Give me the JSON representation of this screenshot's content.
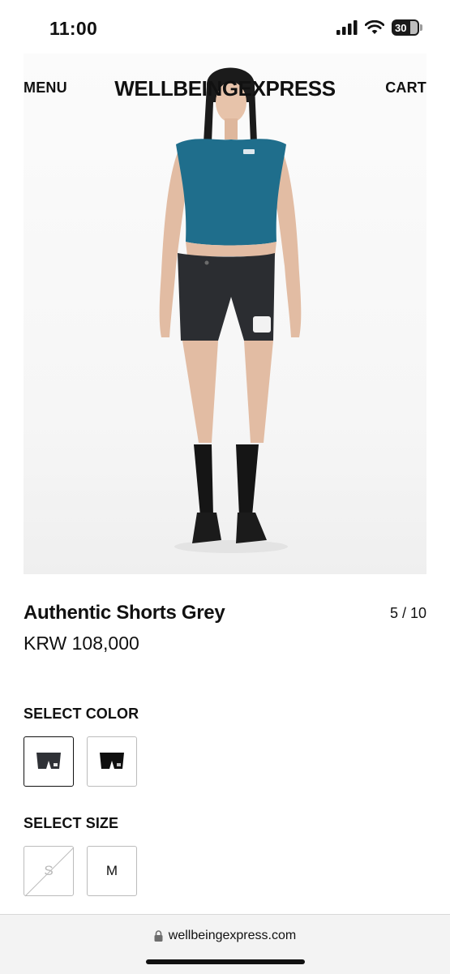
{
  "status_bar": {
    "time": "11:00",
    "battery": "30"
  },
  "header": {
    "menu_label": "MENU",
    "brand": "WELLBEINGEXPRESS",
    "cart_label": "CART"
  },
  "product": {
    "title": "Authentic Shorts Grey",
    "price": "KRW 108,000",
    "gallery_position": "5 / 10"
  },
  "color_section": {
    "label": "SELECT COLOR"
  },
  "size_section": {
    "label": "SELECT SIZE",
    "options": [
      "S",
      "M"
    ]
  },
  "browser": {
    "url": "wellbeingexpress.com"
  },
  "colors": {
    "top": "#1f6e8c",
    "shorts": "#2b2d31",
    "socks": "#151515"
  }
}
